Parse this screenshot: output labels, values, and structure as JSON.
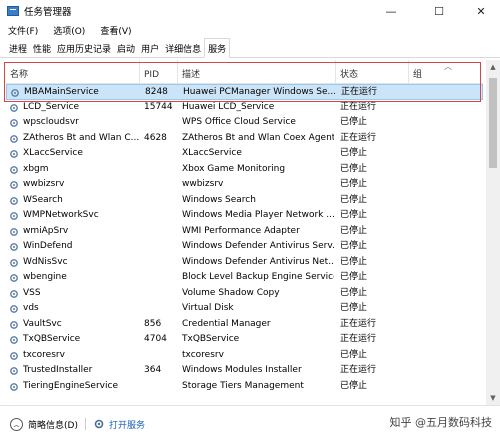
{
  "window": {
    "title": "任务管理器",
    "minimize": "—",
    "maximize": "☐",
    "close": "✕"
  },
  "menu": [
    "文件(F)",
    "选项(O)",
    "查看(V)"
  ],
  "tabs": [
    "进程",
    "性能",
    "应用历史记录",
    "启动",
    "用户",
    "详细信息",
    "服务"
  ],
  "active_tab": "服务",
  "columns": {
    "name": "名称",
    "pid": "PID",
    "desc": "描述",
    "status": "状态",
    "group": "组"
  },
  "rows": [
    {
      "name": "MBAMainService",
      "pid": "8248",
      "desc": "Huawei PCManager Windows Se...",
      "status": "正在运行"
    },
    {
      "name": "LCD_Service",
      "pid": "15744",
      "desc": "Huawei LCD_Service",
      "status": "正在运行"
    },
    {
      "name": "wpscloudsvr",
      "pid": "",
      "desc": "WPS Office Cloud Service",
      "status": "已停止"
    },
    {
      "name": "ZAtheros Bt and Wlan C...",
      "pid": "4628",
      "desc": "ZAtheros Bt and Wlan Coex Agent",
      "status": "正在运行"
    },
    {
      "name": "XLaccService",
      "pid": "",
      "desc": "XLaccService",
      "status": "已停止"
    },
    {
      "name": "xbgm",
      "pid": "",
      "desc": "Xbox Game Monitoring",
      "status": "已停止"
    },
    {
      "name": "wwbizsrv",
      "pid": "",
      "desc": "wwbizsrv",
      "status": "已停止"
    },
    {
      "name": "WSearch",
      "pid": "",
      "desc": "Windows Search",
      "status": "已停止"
    },
    {
      "name": "WMPNetworkSvc",
      "pid": "",
      "desc": "Windows Media Player Network ...",
      "status": "已停止"
    },
    {
      "name": "wmiApSrv",
      "pid": "",
      "desc": "WMI Performance Adapter",
      "status": "已停止"
    },
    {
      "name": "WinDefend",
      "pid": "",
      "desc": "Windows Defender Antivirus Serv...",
      "status": "已停止"
    },
    {
      "name": "WdNisSvc",
      "pid": "",
      "desc": "Windows Defender Antivirus Net...",
      "status": "已停止"
    },
    {
      "name": "wbengine",
      "pid": "",
      "desc": "Block Level Backup Engine Service",
      "status": "已停止"
    },
    {
      "name": "VSS",
      "pid": "",
      "desc": "Volume Shadow Copy",
      "status": "已停止"
    },
    {
      "name": "vds",
      "pid": "",
      "desc": "Virtual Disk",
      "status": "已停止"
    },
    {
      "name": "VaultSvc",
      "pid": "856",
      "desc": "Credential Manager",
      "status": "正在运行"
    },
    {
      "name": "TxQBService",
      "pid": "4704",
      "desc": "TxQBService",
      "status": "正在运行"
    },
    {
      "name": "txcoresrv",
      "pid": "",
      "desc": "txcoresrv",
      "status": "已停止"
    },
    {
      "name": "TrustedInstaller",
      "pid": "364",
      "desc": "Windows Modules Installer",
      "status": "正在运行"
    },
    {
      "name": "TieringEngineService",
      "pid": "",
      "desc": "Storage Tiers Management",
      "status": "已停止"
    }
  ],
  "footer": {
    "less_details": "简略信息(D)",
    "open_services": "打开服务"
  },
  "watermark": "知乎 @五月数码科技",
  "colors": {
    "selected_row": "#cce4f7",
    "highlight_box": "#d9434a"
  }
}
